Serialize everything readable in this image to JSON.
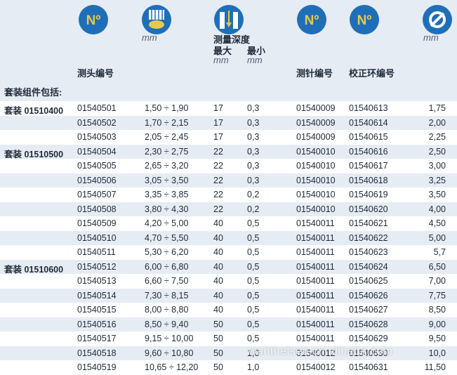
{
  "header": {
    "mm_label_1": "mm",
    "depth_title": "测量深度",
    "depth_max": "最大",
    "depth_min": "最小",
    "depth_max_unit": "mm",
    "depth_min_unit": "mm",
    "mm_label_2": "mm",
    "col_head_number": "测头编号",
    "col_pin_number": "测针编号",
    "col_ring_number": "校正环编号",
    "number_icon_text": "Nº"
  },
  "subheading": "套装组件包括:",
  "rows": [
    {
      "set": "套装 01510400",
      "head": "01540501",
      "range": "1,50 ÷  1,90",
      "max": "17",
      "min": "0,3",
      "pin": "01540009",
      "ring": "01540613",
      "cal": "1,75"
    },
    {
      "set": "",
      "head": "01540502",
      "range": "1,70 ÷  2,15",
      "max": "17",
      "min": "0,3",
      "pin": "01540009",
      "ring": "01540614",
      "cal": "2,00"
    },
    {
      "set": "",
      "head": "01540503",
      "range": "2,05 ÷  2,45",
      "max": "17",
      "min": "0,3",
      "pin": "01540009",
      "ring": "01540615",
      "cal": "2,25"
    },
    {
      "set": "套装 01510500",
      "head": "01540504",
      "range": "2,30 ÷  2,75",
      "max": "22",
      "min": "0,3",
      "pin": "01540010",
      "ring": "01540616",
      "cal": "2,50"
    },
    {
      "set": "",
      "head": "01540505",
      "range": "2,65 ÷  3,20",
      "max": "22",
      "min": "0,3",
      "pin": "01540010",
      "ring": "01540617",
      "cal": "3,00"
    },
    {
      "set": "",
      "head": "01540506",
      "range": "3,05 ÷  3,50",
      "max": "22",
      "min": "0,3",
      "pin": "01540010",
      "ring": "01540618",
      "cal": "3,25"
    },
    {
      "set": "",
      "head": "01540507",
      "range": "3,35 ÷  3,85",
      "max": "22",
      "min": "0,2",
      "pin": "01540010",
      "ring": "01540619",
      "cal": "3,50"
    },
    {
      "set": "",
      "head": "01540508",
      "range": "3,80 ÷  4,30",
      "max": "22",
      "min": "0,2",
      "pin": "01540010",
      "ring": "01540620",
      "cal": "4,00"
    },
    {
      "set": "",
      "head": "01540509",
      "range": "4,20 ÷  5,00",
      "max": "40",
      "min": "0,5",
      "pin": "01540011",
      "ring": "01540621",
      "cal": "4,50"
    },
    {
      "set": "",
      "head": "01540510",
      "range": "4,70 ÷  5,50",
      "max": "40",
      "min": "0,5",
      "pin": "01540011",
      "ring": "01540622",
      "cal": "5,00"
    },
    {
      "set": "",
      "head": "01540511",
      "range": "5,30 ÷  6,20",
      "max": "40",
      "min": "0,5",
      "pin": "01540011",
      "ring": "01540623",
      "cal": "5,7"
    },
    {
      "set": "套装 01510600",
      "head": "01540512",
      "range": "6,00 ÷  6,80",
      "max": "40",
      "min": "0,5",
      "pin": "01540011",
      "ring": "01540624",
      "cal": "6,50"
    },
    {
      "set": "",
      "head": "01540513",
      "range": "6,60 ÷  7,50",
      "max": "40",
      "min": "0,5",
      "pin": "01540011",
      "ring": "01540625",
      "cal": "7,00"
    },
    {
      "set": "",
      "head": "01540514",
      "range": "7,30 ÷  8,15",
      "max": "40",
      "min": "0,5",
      "pin": "01540011",
      "ring": "01540626",
      "cal": "7,75"
    },
    {
      "set": "",
      "head": "01540515",
      "range": "8,00 ÷  8,80",
      "max": "40",
      "min": "0,5",
      "pin": "01540011",
      "ring": "01540627",
      "cal": "8,50"
    },
    {
      "set": "",
      "head": "01540516",
      "range": "8,50 ÷  9,40",
      "max": "50",
      "min": "0,5",
      "pin": "01540011",
      "ring": "01540628",
      "cal": "9,00"
    },
    {
      "set": "",
      "head": "01540517",
      "range": "9,15 ÷ 10,00",
      "max": "50",
      "min": "0,5",
      "pin": "01540011",
      "ring": "01540629",
      "cal": "9,50"
    },
    {
      "set": "",
      "head": "01540518",
      "range": "9,60 ÷ 10,80",
      "max": "50",
      "min": "1,0",
      "pin": "01540012",
      "ring": "01540630",
      "cal": "10,0"
    },
    {
      "set": "",
      "head": "01540519",
      "range": "10,65 ÷ 12,20",
      "max": "50",
      "min": "1,0",
      "pin": "01540012",
      "ring": "01540631",
      "cal": "11,50"
    }
  ],
  "watermark": "wahthelsen.cn.alibaba.com",
  "colors": {
    "band": "#e6ecf3",
    "icon_blue": "#1f6fb8",
    "icon_gold": "#e8c94a"
  }
}
